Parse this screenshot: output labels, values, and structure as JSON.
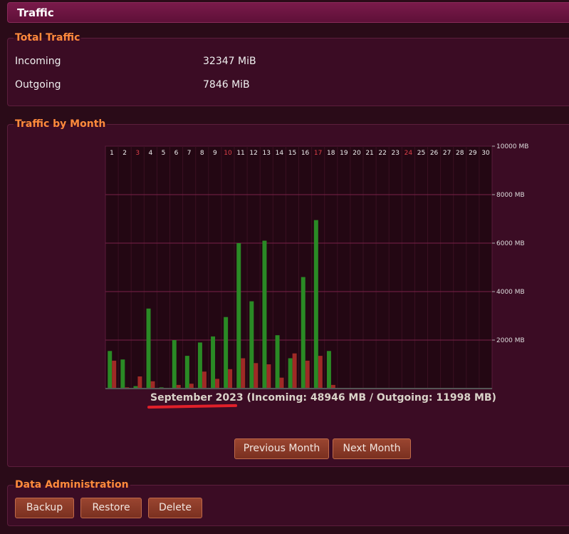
{
  "header": {
    "title": "Traffic"
  },
  "total_traffic": {
    "legend": "Total Traffic",
    "rows": [
      {
        "label": "Incoming",
        "value": "32347 MiB"
      },
      {
        "label": "Outgoing",
        "value": "7846 MiB"
      }
    ]
  },
  "monthly": {
    "legend": "Traffic by Month",
    "caption_month": "September 2023",
    "caption_totals": " (Incoming: 48946 MB / Outgoing: 11998 MB)",
    "prev_label": "Previous Month",
    "next_label": "Next Month"
  },
  "admin": {
    "legend": "Data Administration",
    "backup_label": "Backup",
    "restore_label": "Restore",
    "delete_label": "Delete"
  },
  "colors": {
    "incoming": "#2a8a25",
    "outgoing": "#a02a26",
    "weekend_day": "#e0404a",
    "accent": "#ff8a3c"
  },
  "chart_data": {
    "type": "bar",
    "categories": [
      "1",
      "2",
      "3",
      "4",
      "5",
      "6",
      "7",
      "8",
      "9",
      "10",
      "11",
      "12",
      "13",
      "14",
      "15",
      "16",
      "17",
      "18",
      "19",
      "20",
      "21",
      "22",
      "23",
      "24",
      "25",
      "26",
      "27",
      "28",
      "29",
      "30"
    ],
    "highlighted_categories": [
      "3",
      "10",
      "17",
      "24"
    ],
    "series": [
      {
        "name": "Incoming",
        "values": [
          1550,
          1200,
          100,
          3300,
          50,
          2000,
          1350,
          1900,
          2150,
          2950,
          6000,
          3600,
          6100,
          2200,
          1250,
          4600,
          6950,
          1550,
          0,
          0,
          0,
          0,
          0,
          0,
          0,
          0,
          0,
          0,
          0,
          0
        ]
      },
      {
        "name": "Outgoing",
        "values": [
          1150,
          50,
          500,
          300,
          0,
          150,
          200,
          700,
          400,
          800,
          1250,
          1050,
          1000,
          450,
          1450,
          1150,
          1350,
          150,
          0,
          0,
          0,
          0,
          0,
          0,
          0,
          0,
          0,
          0,
          0,
          0
        ]
      }
    ],
    "yticks": [
      {
        "value": 10000,
        "label": "10000 MB"
      },
      {
        "value": 8000,
        "label": "8000 MB"
      },
      {
        "value": 6000,
        "label": "6000 MB"
      },
      {
        "value": 4000,
        "label": "4000 MB"
      },
      {
        "value": 2000,
        "label": "2000 MB"
      }
    ],
    "ylim": [
      0,
      10000
    ],
    "grid": true,
    "xlabel": "",
    "ylabel": ""
  }
}
